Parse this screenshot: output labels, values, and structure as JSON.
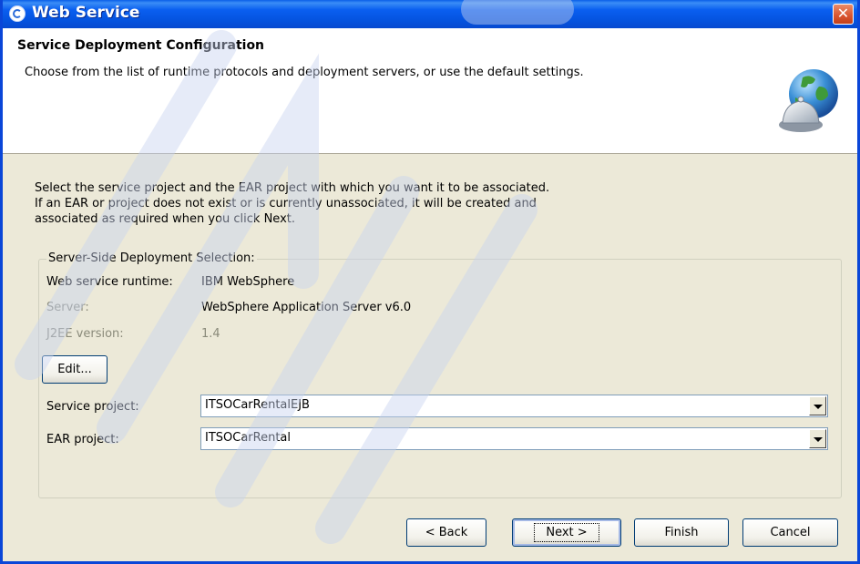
{
  "window": {
    "title": "Web Service",
    "close_glyph": "✕",
    "title_icon": "web-service-icon"
  },
  "header": {
    "title": "Service Deployment Configuration",
    "description": "Choose from the list of runtime protocols and deployment servers, or use the default settings.",
    "image": "globe-bell-icon"
  },
  "instructions": [
    "Select the service project and the EAR project with which you want it to be associated.",
    "If an EAR or project does not exist or is currently unassociated, it will be created and",
    "associated as required when you click Next."
  ],
  "deployment": {
    "legend": "Server-Side Deployment Selection:",
    "runtime_label": "Web service runtime:",
    "runtime_value": "IBM WebSphere",
    "server_label": "Server:",
    "server_value": "WebSphere Application Server v6.0",
    "j2ee_label": "J2EE version:",
    "j2ee_value": "1.4",
    "edit_label": "Edit...",
    "service_project_label": "Service project:",
    "service_project_value": "ITSOCarRentalEJB",
    "ear_project_label": "EAR project:",
    "ear_project_value": "ITSOCarRental"
  },
  "buttons": {
    "back": "< Back",
    "next": "Next >",
    "finish": "Finish",
    "cancel": "Cancel"
  },
  "colors": {
    "titlebar": "#0554e0",
    "dialog_bg": "#ece9d8",
    "header_bg": "#ffffff",
    "close_button": "#d9542e"
  }
}
